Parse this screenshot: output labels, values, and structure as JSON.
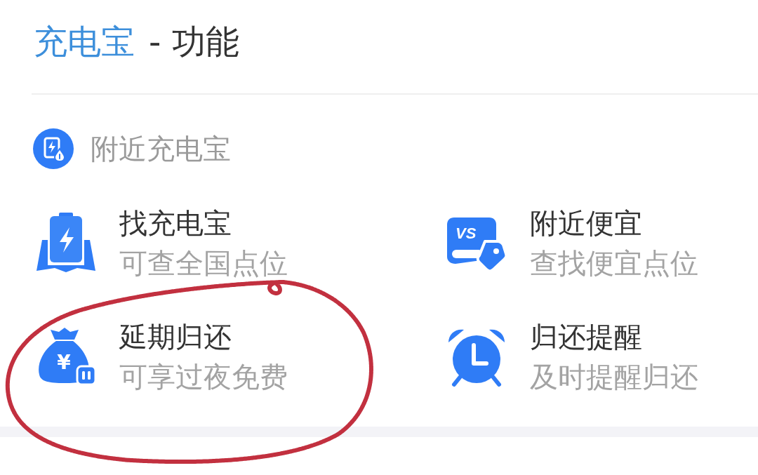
{
  "header": {
    "title_highlight": "充电宝",
    "title_rest": "- 功能"
  },
  "section": {
    "title": "附近充电宝"
  },
  "features": [
    {
      "kind": "battery",
      "title": "找充电宝",
      "subtitle": "可查全国点位",
      "circled": false
    },
    {
      "kind": "price-tag",
      "icon_text": "VS",
      "title": "附近便宜",
      "subtitle": "查找便宜点位",
      "circled": false
    },
    {
      "kind": "money-bag",
      "icon_text": "¥",
      "title": "延期归还",
      "subtitle": "可享过夜免费",
      "circled": true
    },
    {
      "kind": "alarm-clock",
      "title": "归还提醒",
      "subtitle": "及时提醒归还",
      "circled": false
    }
  ]
}
